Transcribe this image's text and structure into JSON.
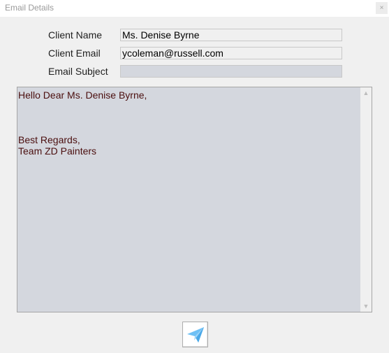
{
  "window": {
    "title": "Email Details",
    "close_label": "×"
  },
  "form": {
    "client_name_label": "Client Name",
    "client_name_value": "Ms. Denise Byrne",
    "client_email_label": "Client Email",
    "client_email_value": "ycoleman@russell.com",
    "email_subject_label": "Email Subject",
    "email_subject_value": ""
  },
  "message": {
    "body": "Hello Dear Ms. Denise Byrne,\n\n\n\nBest Regards,\nTeam ZD Painters"
  },
  "scrollbar": {
    "up_arrow": "▲",
    "down_arrow": "▼"
  },
  "actions": {
    "send_icon": "paper-plane-icon",
    "send_icon_color": "#6ec0f5"
  }
}
